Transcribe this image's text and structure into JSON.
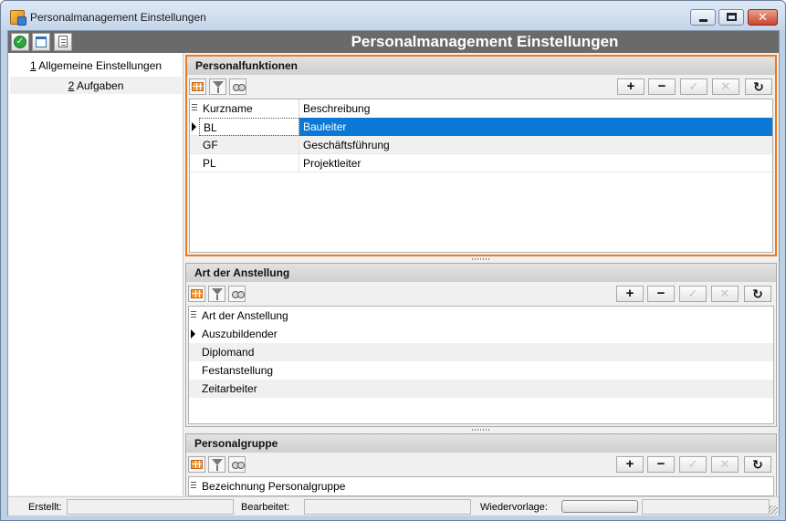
{
  "window": {
    "title": "Personalmanagement Einstellungen",
    "header_title": "Personalmanagement Einstellungen",
    "accent_color": "#f07a20",
    "selection_color": "#0a78d4"
  },
  "nav": {
    "items": [
      {
        "num": "1",
        "label": "Allgemeine Einstellungen"
      },
      {
        "num": "2",
        "label": "Aufgaben"
      }
    ]
  },
  "panels": {
    "funktionen": {
      "title": "Personalfunktionen",
      "columns": [
        "Kurzname",
        "Beschreibung"
      ],
      "rows": [
        {
          "kurz": "BL",
          "beschreibung": "Bauleiter"
        },
        {
          "kurz": "GF",
          "beschreibung": "Geschäftsführung"
        },
        {
          "kurz": "PL",
          "beschreibung": "Projektleiter"
        }
      ]
    },
    "anstellung": {
      "title": "Art der Anstellung",
      "column": "Art der Anstellung",
      "rows": [
        "Auszubildender",
        "Diplomand",
        "Festanstellung",
        "Zeitarbeiter"
      ]
    },
    "gruppe": {
      "title": "Personalgruppe",
      "column": "Bezeichnung Personalgruppe"
    }
  },
  "actions": {
    "add": "+",
    "remove": "−",
    "confirm": "✓",
    "cancel": "✕",
    "refresh": "↻"
  },
  "statusbar": {
    "created_label": "Erstellt:",
    "edited_label": "Bearbeitet:",
    "followup_label": "Wiedervorlage:"
  }
}
